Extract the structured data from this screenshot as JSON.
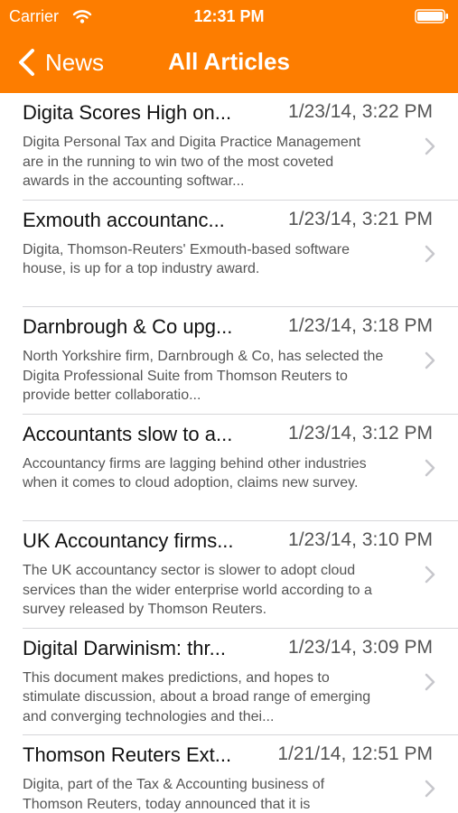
{
  "status_bar": {
    "carrier": "Carrier",
    "time": "12:31 PM",
    "icons": [
      "wifi-icon",
      "battery-icon"
    ]
  },
  "nav_bar": {
    "back_label": "News",
    "title": "All Articles",
    "color": "#fd7d00"
  },
  "articles": [
    {
      "title": "Digita Scores High on...",
      "date": "1/23/14, 3:22 PM",
      "summary": "Digita Personal Tax and Digita Practice Management are in the running to win two of the most coveted awards in the accounting softwar..."
    },
    {
      "title": "Exmouth accountanc...",
      "date": "1/23/14, 3:21 PM",
      "summary": "Digita, Thomson-Reuters' Exmouth-based software house, is up for a top industry award."
    },
    {
      "title": "Darnbrough & Co upg...",
      "date": "1/23/14, 3:18 PM",
      "summary": "North Yorkshire firm, Darnbrough & Co, has selected the Digita Professional Suite from Thomson Reuters to provide better collaboratio..."
    },
    {
      "title": "Accountants slow to a...",
      "date": "1/23/14, 3:12 PM",
      "summary": "Accountancy firms are lagging behind other industries when it comes to cloud adoption, claims new survey."
    },
    {
      "title": "UK Accountancy firms...",
      "date": "1/23/14, 3:10 PM",
      "summary": "The UK accountancy sector is slower to adopt cloud services than the wider enterprise world according to a survey released by Thomson Reuters."
    },
    {
      "title": "Digital Darwinism: thr...",
      "date": "1/23/14, 3:09 PM",
      "summary": "This document makes predictions, and hopes to stimulate discussion, about a broad range of emerging and converging technologies and thei..."
    },
    {
      "title": "Thomson Reuters Ext...",
      "date": "1/21/14, 12:51 PM",
      "summary": "Digita, part of the Tax & Accounting business of Thomson Reuters, today announced that it is"
    }
  ]
}
